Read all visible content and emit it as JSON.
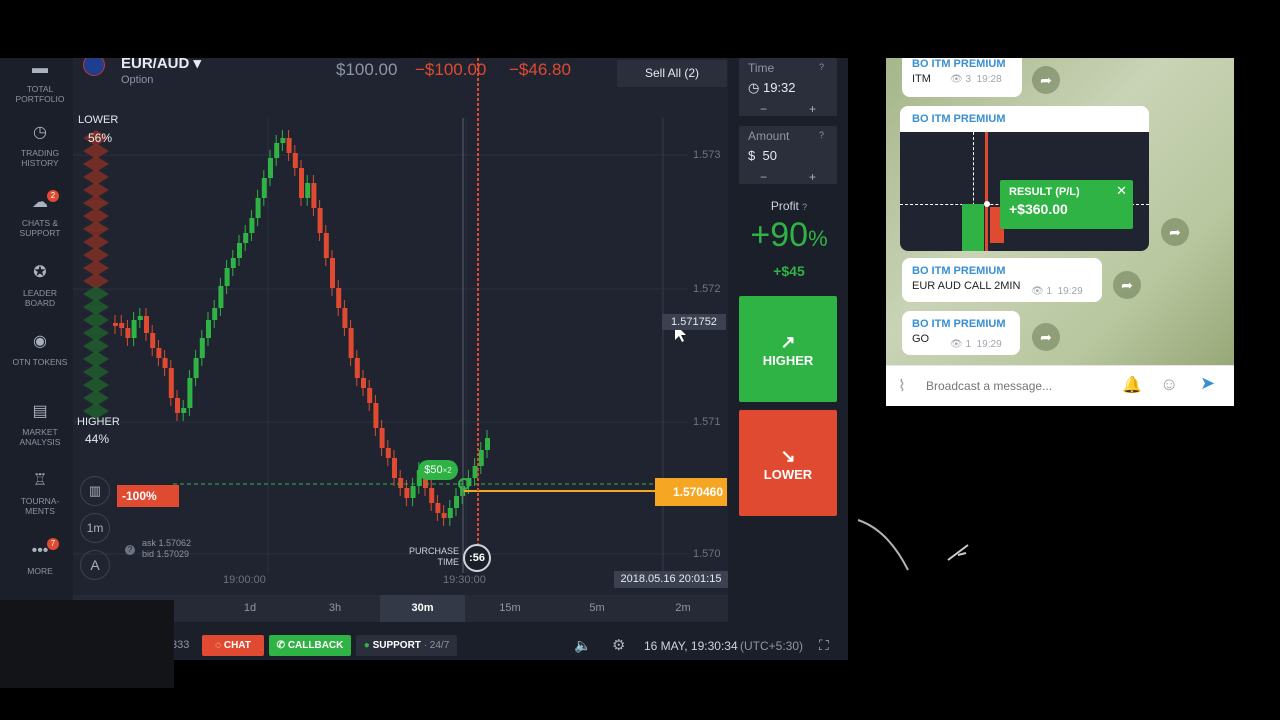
{
  "sidebar": {
    "items": [
      {
        "label": "TOTAL PORTFOLIO",
        "icon": "briefcase-icon"
      },
      {
        "label": "TRADING HISTORY",
        "icon": "history-icon"
      },
      {
        "label": "CHATS & SUPPORT",
        "icon": "chat-icon",
        "badge": "2"
      },
      {
        "label": "LEADER BOARD",
        "icon": "leaderboard-icon"
      },
      {
        "label": "OTN TOKENS",
        "icon": "token-icon"
      },
      {
        "label": "MARKET ANALYSIS",
        "icon": "analysis-icon"
      },
      {
        "label": "TOURNA-MENTS",
        "icon": "trophy-icon"
      },
      {
        "label": "MORE",
        "icon": "more-icon",
        "badge": "7"
      }
    ]
  },
  "asset": {
    "name": "EUR/AUD",
    "type": "Option"
  },
  "summary": {
    "invested": "$100.00",
    "loss": "−$100.00",
    "profit": "−$46.80"
  },
  "sell_all": "Sell All (2)",
  "sentiment": {
    "lower_label": "LOWER",
    "lower_pct": "56%",
    "higher_label": "HIGHER",
    "higher_pct": "44%"
  },
  "chart": {
    "price_labels": [
      "1.573",
      "1.572",
      "1.571",
      "1.570"
    ],
    "current_price": "1.571752",
    "strike_price": "1.570460",
    "loss_tag": "-100%",
    "deal_tag": "$50",
    "deal_mult": "×2",
    "time_labels": [
      "19:00:00",
      "19:30:00"
    ],
    "ask": "ask 1.57062",
    "bid": "bid 1.57029",
    "purchase_time": "PURCHASE TIME",
    "countdown": ":56",
    "datetime": "2018.05.16 20:01:15",
    "timeframe": "1m"
  },
  "timeframes": [
    "1d",
    "3h",
    "30m",
    "15m",
    "5m",
    "2m"
  ],
  "active_timeframe": "30m",
  "trade": {
    "time_label": "Time",
    "time_value": "19:32",
    "amount_label": "Amount",
    "amount_value": "50",
    "currency": "$",
    "minus": "−",
    "plus": "+",
    "profit_label": "Profit",
    "profit_pct": "+90",
    "profit_pct_unit": "%",
    "profit_amount": "+$45",
    "higher": "HIGHER",
    "lower": "LOWER"
  },
  "bottom": {
    "id_fragment": "333",
    "chat": "CHAT",
    "callback": "CALLBACK",
    "support": "SUPPORT",
    "support_suffix": "· 24/7",
    "datetime": "16 MAY, 19:30:34",
    "tz": "(UTC+5:30)"
  },
  "telegram": {
    "messages": [
      {
        "from": "BO ITM PREMIUM",
        "text": "ITM",
        "views": "3",
        "time": "19:28"
      },
      {
        "from": "BO ITM PREMIUM",
        "result_label": "RESULT (P/L)",
        "result_value": "+$360.00"
      },
      {
        "from": "BO ITM PREMIUM",
        "text": "EUR AUD CALL 2MIN",
        "views": "1",
        "time": "19:29"
      },
      {
        "from": "BO ITM PREMIUM",
        "text": "GO",
        "views": "1",
        "time": "19:29"
      }
    ],
    "input_placeholder": "Broadcast a message..."
  },
  "colors": {
    "up": "#2fb344",
    "down": "#e04a31",
    "accent": "#f5a623",
    "bg": "#1f2430"
  }
}
